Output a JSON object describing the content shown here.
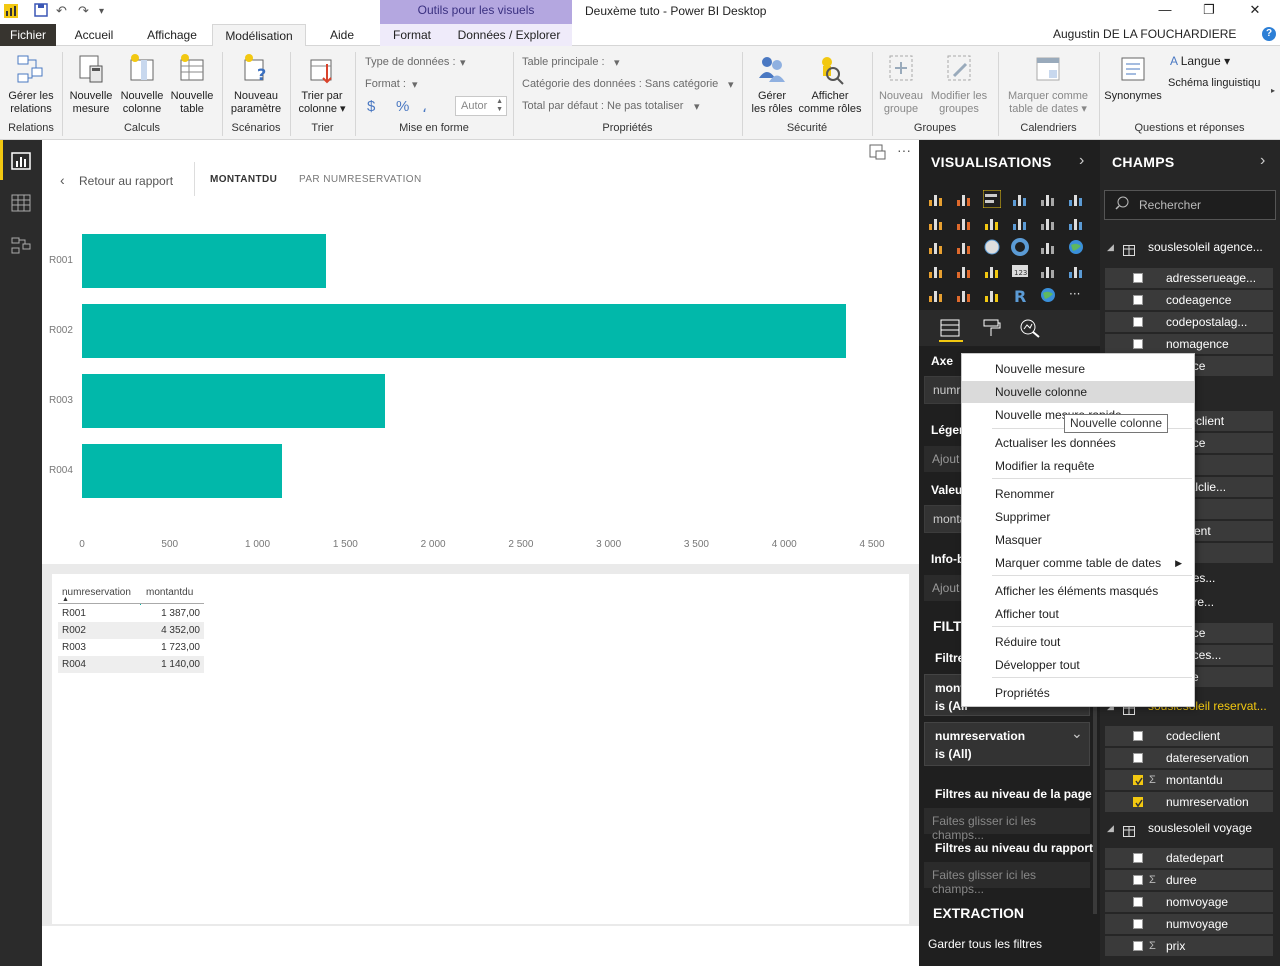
{
  "window": {
    "contextual_tab_group": "Outils pour les visuels",
    "title": "Deuxème tuto - Power BI Desktop",
    "user": "Augustin DE LA FOUCHARDIERE",
    "help": "?",
    "minimize": "—",
    "maximize": "❐",
    "close": "✕"
  },
  "tabs": [
    "Fichier",
    "Accueil",
    "Affichage",
    "Modélisation",
    "Aide"
  ],
  "context_tabs": [
    "Format",
    "Données / Explorer"
  ],
  "ribbon": {
    "buttons": [
      {
        "label1": "Gérer les",
        "label2": "relations"
      },
      {
        "label1": "Nouvelle",
        "label2": "mesure"
      },
      {
        "label1": "Nouvelle",
        "label2": "colonne"
      },
      {
        "label1": "Nouvelle",
        "label2": "table"
      },
      {
        "label1": "Nouveau",
        "label2": "paramètre"
      },
      {
        "label1": "Trier par",
        "label2": "colonne ▾"
      },
      {
        "label1": "Gérer",
        "label2": "les rôles"
      },
      {
        "label1": "Afficher",
        "label2": "comme rôles"
      },
      {
        "label1": "Nouveau",
        "label2": "groupe"
      },
      {
        "label1": "Modifier les",
        "label2": "groupes"
      },
      {
        "label1": "Marquer comme",
        "label2": "table de dates ▾"
      },
      {
        "label1": "Synonymes",
        "label2": ""
      }
    ],
    "format": {
      "data_type": "Type de données :",
      "format": "Format :",
      "currency": "$",
      "percent": "%",
      "comma": "،",
      "decimals": "Autor"
    },
    "properties": {
      "home_table": "Table principale :",
      "data_category": "Catégorie des données : Sans catégorie",
      "default_summary": "Total par défaut : Ne pas totaliser"
    },
    "qa": {
      "language": "Langue ▾",
      "linguistic": "Schéma linguistiqu"
    },
    "groups": [
      "Relations",
      "Calculs",
      "Scénarios",
      "Trier",
      "Mise en forme",
      "Propriétés",
      "Sécurité",
      "Groupes",
      "Calendriers",
      "Questions et réponses"
    ]
  },
  "canvas": {
    "back": "Retour au rapport",
    "crumb_active": "MONTANTDU",
    "crumb_rest": "PAR NUMRESERVATION",
    "more": "···"
  },
  "chart_data": {
    "type": "bar",
    "orientation": "horizontal",
    "categories": [
      "R001",
      "R002",
      "R003",
      "R004"
    ],
    "values": [
      1387,
      4352,
      1723,
      1140
    ],
    "xlim": [
      0,
      4500
    ],
    "xticks": [
      "0",
      "500",
      "1 000",
      "1 500",
      "2 000",
      "2 500",
      "3 000",
      "3 500",
      "4 000",
      "4 500"
    ],
    "color": "#01b8aa"
  },
  "table": {
    "columns": [
      "numreservation",
      "montantdu"
    ],
    "rows": [
      [
        "R001",
        "1 387,00"
      ],
      [
        "R002",
        "4 352,00"
      ],
      [
        "R003",
        "1 723,00"
      ],
      [
        "R004",
        "1 140,00"
      ]
    ]
  },
  "viz_panel": {
    "title": "VISUALISATIONS",
    "axis": "Axe",
    "axis_value": "numr",
    "legend": "Légen",
    "legend_add": "Ajout",
    "values": "Valeu",
    "values_value": "monta",
    "tooltips": "Info-b",
    "tooltips_add": "Ajout",
    "filters": "FILT",
    "filters_visual": "Filtre",
    "filter1_name": "mont",
    "filter1_state": "is (All",
    "filter2_name": "numreservation",
    "filter2_state": "is (All)",
    "page_filters": "Filtres au niveau de la page",
    "page_filters_drop": "Faites glisser ici les champs...",
    "report_filters": "Filtres au niveau du rapport",
    "report_filters_drop": "Faites glisser ici les champs...",
    "drillthrough": "EXTRACTION",
    "keep_filters": "Garder tous les filtres"
  },
  "fields_panel": {
    "title": "CHAMPS",
    "search_placeholder": "Rechercher",
    "agence_table": "souslesoleil agence...",
    "agence_fields": [
      "adresserueage...",
      "codeagence",
      "codepostalag...",
      "nomagence",
      "agence"
    ],
    "client_table": "eil client",
    "client_fields": [
      "serueclient",
      "agence",
      "client",
      "postalclie...",
      "client",
      "omclient",
      "client"
    ],
    "lignes_table": "eil ligneres...",
    "nombre_table": "eil nombre...",
    "nombre_fields": [
      "agence",
      "replaces...",
      "oyage"
    ],
    "reservation_table": "souslesoleil reservat...",
    "reservation_fields": [
      {
        "name": "codeclient",
        "checked": false,
        "sigma": false
      },
      {
        "name": "datereservation",
        "checked": false,
        "sigma": false
      },
      {
        "name": "montantdu",
        "checked": true,
        "sigma": true
      },
      {
        "name": "numreservation",
        "checked": true,
        "sigma": false
      }
    ],
    "voyage_table": "souslesoleil voyage",
    "voyage_fields": [
      {
        "name": "datedepart",
        "sigma": false
      },
      {
        "name": "duree",
        "sigma": true
      },
      {
        "name": "nomvoyage",
        "sigma": false
      },
      {
        "name": "numvoyage",
        "sigma": false
      },
      {
        "name": "prix",
        "sigma": true
      }
    ]
  },
  "context_menu": {
    "items": [
      "Nouvelle mesure",
      "Nouvelle colonne",
      "Nouvelle mesure rapide",
      "Actualiser les données",
      "Modifier la requête",
      "Renommer",
      "Supprimer",
      "Masquer",
      "Marquer comme table de dates",
      "Afficher les éléments masqués",
      "Afficher tout",
      "Réduire tout",
      "Développer tout",
      "Propriétés"
    ],
    "tooltip": "Nouvelle colonne"
  }
}
